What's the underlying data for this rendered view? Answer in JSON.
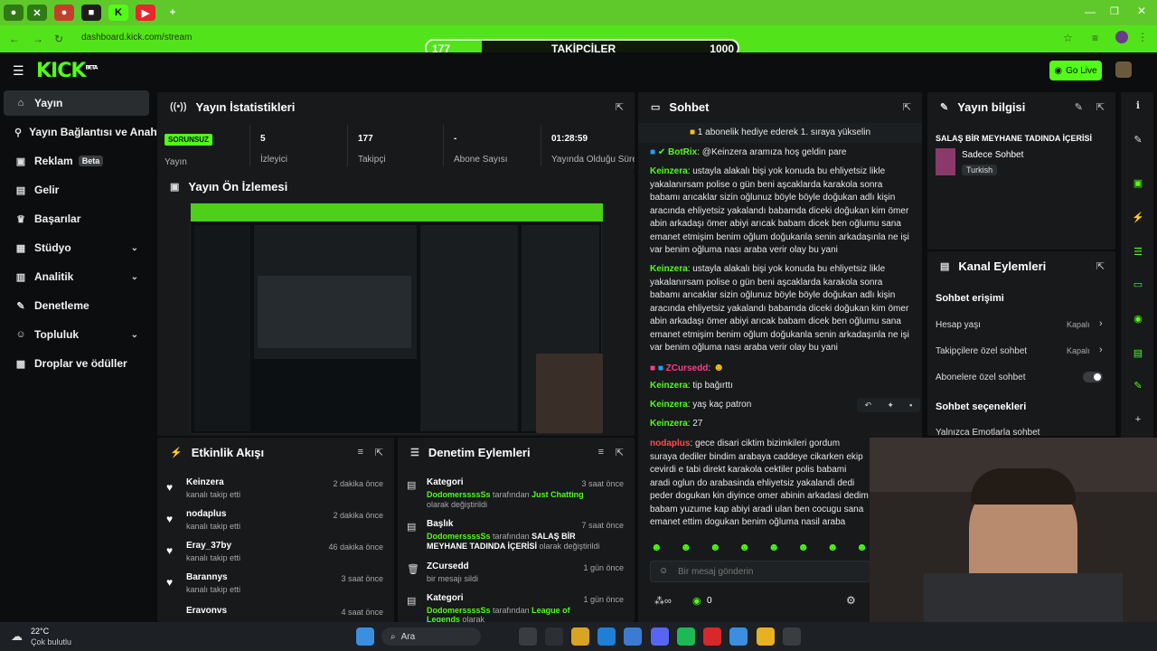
{
  "browser": {
    "url": "dashboard.kick.com/stream",
    "follow_bar": {
      "current": "177",
      "label": "TAKİPÇİLER",
      "goal": "1000",
      "progress": 0.177
    }
  },
  "header": {
    "logo": "KICK",
    "logo_sup": "BETA",
    "go_live": "Go Live"
  },
  "sidebar": {
    "items": [
      {
        "label": "Yayın",
        "icon": "home-icon"
      },
      {
        "label": "Yayın Bağlantısı ve Anahtarı",
        "icon": "link-icon"
      },
      {
        "label": "Reklam",
        "badge": "Beta",
        "icon": "ad-icon"
      },
      {
        "label": "Gelir",
        "icon": "wallet-icon"
      },
      {
        "label": "Başarılar",
        "icon": "trophy-icon"
      },
      {
        "label": "Stüdyo",
        "icon": "studio-icon"
      },
      {
        "label": "Analitik",
        "icon": "chart-icon"
      },
      {
        "label": "Denetleme",
        "icon": "wrench-icon"
      },
      {
        "label": "Topluluk",
        "icon": "community-icon"
      },
      {
        "label": "Droplar ve ödüller",
        "icon": "gift-icon"
      }
    ]
  },
  "stats": {
    "title": "Yayın İstatistikleri",
    "status_badge": "SORUNSUZ",
    "status_label": "Yayın",
    "items": [
      {
        "value": "5",
        "label": "İzleyici"
      },
      {
        "value": "177",
        "label": "Takipçi"
      },
      {
        "value": "-",
        "label": "Abone Sayısı"
      },
      {
        "value": "01:28:59",
        "label": "Yayında Olduğu Süre"
      }
    ]
  },
  "preview": {
    "title": "Yayın Ön İzlemesi"
  },
  "activity": {
    "title": "Etkinlik Akışı",
    "items": [
      {
        "name": "Keinzera",
        "sub": "kanalı takip etti",
        "time": "2 dakika önce"
      },
      {
        "name": "nodaplus",
        "sub": "kanalı takip etti",
        "time": "2 dakika önce"
      },
      {
        "name": "Eray_37by",
        "sub": "kanalı takip etti",
        "time": "46 dakika önce"
      },
      {
        "name": "Barannys",
        "sub": "kanalı takip etti",
        "time": "3 saat önce"
      },
      {
        "name": "Eravonvs",
        "sub": "",
        "time": "4 saat önce"
      }
    ]
  },
  "moderation": {
    "title": "Denetim Eylemleri",
    "items": [
      {
        "title": "Kategori",
        "time": "3 saat önce",
        "user": "DodomerssssSs",
        "mid": " tarafından ",
        "target": "Just Chatting",
        "end": " olarak değiştirildi"
      },
      {
        "title": "Başlık",
        "time": "7 saat önce",
        "user": "DodomerssssSs",
        "mid": " tarafından ",
        "target": "SALAŞ BİR MEYHANE TADINDA İÇERİSİ",
        "end": " olarak değiştirildi"
      },
      {
        "title": "ZCursedd",
        "time": "1 gün önce",
        "user": "",
        "mid": "bir mesajı sildi",
        "target": "",
        "end": ""
      },
      {
        "title": "Kategori",
        "time": "1 gün önce",
        "user": "DodomerssssSs",
        "mid": " tarafından ",
        "target": "League of Legends",
        "end": " olarak"
      }
    ]
  },
  "chat": {
    "title": "Sohbet",
    "pinned": "1 abonelik hediye ederek 1. sıraya yükselin",
    "messages": [
      {
        "user": "BotRix",
        "color": "#53fc18",
        "text": "@Keinzera aramıza hoş geldin pare"
      },
      {
        "user": "Keinzera",
        "color": "#53fc18",
        "text": "ustayla alakalı bişi yok konuda bu ehliyetsiz likle yakalanırsam polise o gün beni aşcaklarda karakola sonra babamı arıcaklar sizin oğlunuz böyle böyle doğukan adlı kişin aracında ehliyetsiz yakalandı babamda diceki doğukan kim ömer abin arkadaşı ömer abiyi arıcak babam dicek ben oğlumu sana emanet etmişim benim oğlum doğukanla senin arkadaşınla ne işi var benim oğluma nası araba verir olay bu yani"
      },
      {
        "user": "Keinzera",
        "color": "#53fc18",
        "text": "ustayla alakalı bişi yok konuda bu ehliyetsiz likle yakalanırsam polise o gün beni aşcaklarda karakola sonra babamı arıcaklar sizin oğlunuz böyle böyle doğukan adlı kişin aracında ehliyetsiz yakalandı babamda diceki doğukan kim ömer abin arkadaşı ömer abiyi arıcak babam dicek ben oğlumu sana emanet etmişim benim oğlum doğukanla senin arkadaşınla ne işi var benim oğluma nası araba verir olay bu yani"
      },
      {
        "user": "ZCursedd",
        "color": "#ff3d8b",
        "text": ""
      },
      {
        "user": "Keinzera",
        "color": "#53fc18",
        "text": "tip bağırttı"
      },
      {
        "user": "Keinzera",
        "color": "#53fc18",
        "text": "yaş kaç patron"
      },
      {
        "user": "Keinzera",
        "color": "#53fc18",
        "text": "27"
      },
      {
        "user": "nodaplus",
        "color": "#ff4d4d",
        "text": "gece disari ciktim bizimkileri gordum suraya dediler bindim arabaya caddeye cikarken ekip cevirdi e tabi direkt karakola cektiler polis babami aradi oglun do arabasinda ehliyetsiz yakalandi dedi peder dogukan kin diyince omer abinin arkadasi dedim babam yuzume kap abiyi aradi ulan ben cocugu sana emanet ettim dogukan benim oğluma nasil araba veriyonuz diye ortaligi yikti ol"
      }
    ],
    "input_placeholder": "Bir mesaj gönderin",
    "points": "0"
  },
  "stream_info": {
    "title": "Yayın bilgisi",
    "stream_title": "SALAŞ BİR MEYHANE TADINDA İÇERİSİ",
    "category": "Sadece Sohbet",
    "language": "Turkish"
  },
  "channel_actions": {
    "title": "Kanal Eylemleri",
    "section1": "Sohbet erişimi",
    "rows": [
      {
        "label": "Hesap yaşı",
        "value": "Kapalı"
      },
      {
        "label": "Takipçilere özel sohbet",
        "value": "Kapalı"
      },
      {
        "label": "Abonelere özel sohbet",
        "value": ""
      }
    ],
    "section2": "Sohbet seçenekleri",
    "row_emote": "Yalnızca Emotlarla sohbet"
  },
  "taskbar": {
    "temp": "22°C",
    "weather": "Çok bulutlu",
    "search": "Ara"
  }
}
